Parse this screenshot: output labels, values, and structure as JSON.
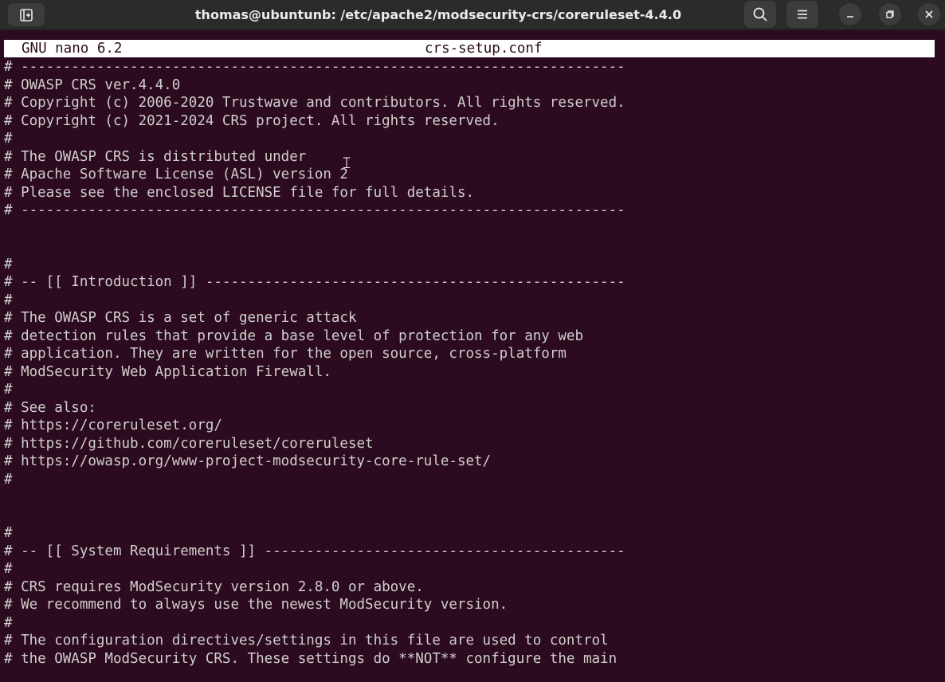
{
  "window": {
    "title": "thomas@ubuntunb: /etc/apache2/modsecurity-crs/coreruleset-4.4.0",
    "icons": {
      "new_tab": "new-tab-icon",
      "search": "search-icon",
      "menu": "hamburger-menu-icon",
      "minimize": "minimize-icon",
      "maximize": "restore-icon",
      "close": "close-icon"
    }
  },
  "nano": {
    "version": "GNU nano 6.2",
    "filename": "crs-setup.conf"
  },
  "lines": [
    "# ------------------------------------------------------------------------",
    "# OWASP CRS ver.4.4.0",
    "# Copyright (c) 2006-2020 Trustwave and contributors. All rights reserved.",
    "# Copyright (c) 2021-2024 CRS project. All rights reserved.",
    "#",
    "# The OWASP CRS is distributed under",
    "# Apache Software License (ASL) version 2",
    "# Please see the enclosed LICENSE file for full details.",
    "# ------------------------------------------------------------------------",
    "",
    "",
    "#",
    "# -- [[ Introduction ]] --------------------------------------------------",
    "#",
    "# The OWASP CRS is a set of generic attack",
    "# detection rules that provide a base level of protection for any web",
    "# application. They are written for the open source, cross-platform",
    "# ModSecurity Web Application Firewall.",
    "#",
    "# See also:",
    "# https://coreruleset.org/",
    "# https://github.com/coreruleset/coreruleset",
    "# https://owasp.org/www-project-modsecurity-core-rule-set/",
    "#",
    "",
    "",
    "#",
    "# -- [[ System Requirements ]] -------------------------------------------",
    "#",
    "# CRS requires ModSecurity version 2.8.0 or above.",
    "# We recommend to always use the newest ModSecurity version.",
    "#",
    "# The configuration directives/settings in this file are used to control",
    "# the OWASP ModSecurity CRS. These settings do **NOT** configure the main"
  ]
}
